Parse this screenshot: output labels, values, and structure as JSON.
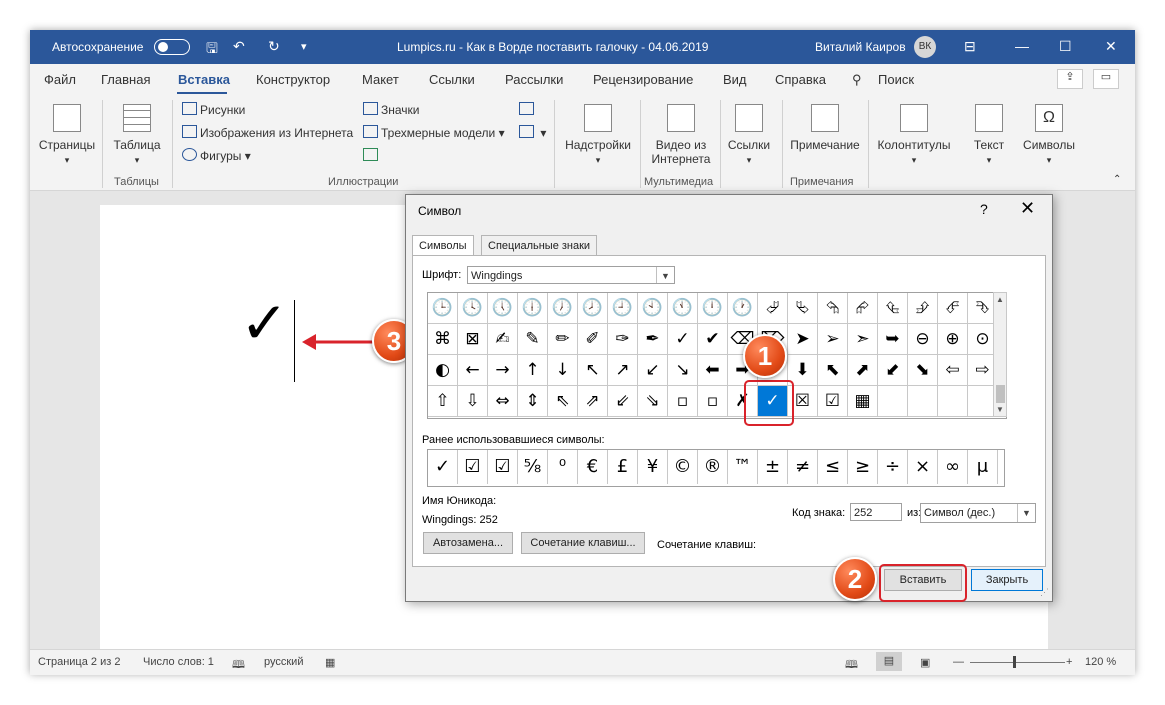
{
  "titlebar": {
    "autosave": "Автосохранение",
    "doc_title": "Lumpics.ru - Как в Ворде поставить галочку - 04.06.2019",
    "user_name": "Виталий Каиров",
    "avatar_initials": "ВК"
  },
  "menu": [
    "Файл",
    "Главная",
    "Вставка",
    "Конструктор",
    "Макет",
    "Ссылки",
    "Рассылки",
    "Рецензирование",
    "Вид",
    "Справка",
    "Поиск"
  ],
  "ribbon": {
    "pages": "Страницы",
    "table": "Таблица",
    "tables_group": "Таблицы",
    "pictures": "Рисунки",
    "online_pictures": "Изображения из Интернета",
    "shapes": "Фигуры",
    "icons": "Значки",
    "models3d": "Трехмерные модели",
    "illustrations_group": "Иллюстрации",
    "addins": "Надстройки",
    "video_line1": "Видео из",
    "video_line2": "Интернета",
    "media_group": "Мультимедиа",
    "links": "Ссылки",
    "comment": "Примечание",
    "comments_group": "Примечания",
    "header_footer": "Колонтитулы",
    "text": "Текст",
    "symbols": "Символы"
  },
  "document": {
    "symbol": "✓"
  },
  "statusbar": {
    "page": "Страница 2 из 2",
    "words": "Число слов: 1",
    "lang": "русский",
    "zoom": "120 %"
  },
  "dialog": {
    "title": "Символ",
    "help": "?",
    "close": "✕",
    "tab_symbols": "Символы",
    "tab_special": "Специальные знаки",
    "font_label": "Шрифт:",
    "font_value": "Wingdings",
    "recent_label": "Ранее использовавшиеся символы:",
    "unicode_name_label": "Имя Юникода:",
    "unicode_name_value": "Wingdings: 252",
    "char_code_label": "Код знака:",
    "char_code_value": "252",
    "from_label": "из:",
    "from_value": "Символ (дес.)",
    "autocorrect_btn": "Автозамена...",
    "shortcut_btn": "Сочетание клавиш...",
    "shortcut_label": "Сочетание клавиш:",
    "insert_btn": "Вставить",
    "close_btn": "Закрыть"
  },
  "symbol_grid": [
    [
      "🕒",
      "🕓",
      "🕔",
      "🕕",
      "🕖",
      "🕗",
      "🕘",
      "🕙",
      "🕚",
      "🕛",
      "🕐",
      "⮰",
      "⮱",
      "⮲",
      "⮳",
      "⮴",
      "⮵",
      "⮶",
      "⮷"
    ],
    [
      "⌘",
      "⊠",
      "✍",
      "✎",
      "✏",
      "✐",
      "✑",
      "✒",
      "✓",
      "✔",
      "⌫",
      "⌦",
      "➤",
      "➢",
      "➣",
      "➥",
      "⊖",
      "⊕",
      "⊙"
    ],
    [
      "◐",
      "←",
      "→",
      "↑",
      "↓",
      "↖",
      "↗",
      "↙",
      "↘",
      "⬅",
      "➡",
      "⬆",
      "⬇",
      "⬉",
      "⬈",
      "⬋",
      "⬊",
      "⇦",
      "⇨"
    ],
    [
      "⇧",
      "⇩",
      "⇔",
      "⇕",
      "⇖",
      "⇗",
      "⇙",
      "⇘",
      "▫",
      "▫",
      "✗",
      "✓",
      "☒",
      "☑",
      "▦",
      "",
      "",
      "",
      ""
    ]
  ],
  "selected_cell": "✓",
  "recent_symbols": [
    "✓",
    "☑",
    "☑",
    "⅝",
    "⁰",
    "€",
    "£",
    "¥",
    "©",
    "®",
    "™",
    "±",
    "≠",
    "≤",
    "≥",
    "÷",
    "×",
    "∞",
    "μ"
  ],
  "callouts": [
    "1",
    "2",
    "3"
  ],
  "colors": {
    "accent": "#2b579a",
    "highlight": "#d9232b",
    "selection": "#0078d7"
  }
}
